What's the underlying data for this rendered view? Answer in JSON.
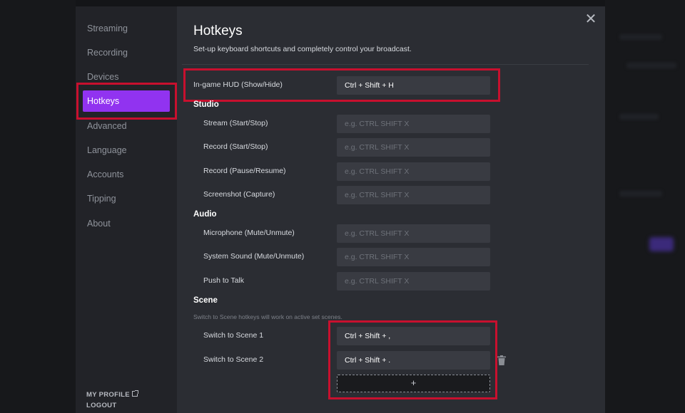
{
  "sidebar": {
    "items": [
      {
        "label": "Streaming"
      },
      {
        "label": "Recording"
      },
      {
        "label": "Devices"
      },
      {
        "label": "Hotkeys"
      },
      {
        "label": "Advanced"
      },
      {
        "label": "Language"
      },
      {
        "label": "Accounts"
      },
      {
        "label": "Tipping"
      },
      {
        "label": "About"
      }
    ],
    "active": "Hotkeys",
    "my_profile": "MY PROFILE",
    "logout": "LOGOUT"
  },
  "header": {
    "title": "Hotkeys",
    "subtitle": "Set-up keyboard shortcuts and completely control your broadcast.",
    "close_icon": "close-icon"
  },
  "hud": {
    "label": "In-game HUD (Show/Hide)",
    "value": "Ctrl + Shift + H"
  },
  "placeholder": "e.g. CTRL SHIFT X",
  "studio": {
    "heading": "Studio",
    "rows": [
      {
        "label": "Stream (Start/Stop)",
        "value": ""
      },
      {
        "label": "Record (Start/Stop)",
        "value": ""
      },
      {
        "label": "Record (Pause/Resume)",
        "value": ""
      },
      {
        "label": "Screenshot (Capture)",
        "value": ""
      }
    ]
  },
  "audio": {
    "heading": "Audio",
    "rows": [
      {
        "label": "Microphone (Mute/Unmute)",
        "value": ""
      },
      {
        "label": "System Sound (Mute/Unmute)",
        "value": ""
      },
      {
        "label": "Push to Talk",
        "value": ""
      }
    ]
  },
  "scene": {
    "heading": "Scene",
    "note": "Switch to Scene hotkeys will work on active set scenes.",
    "rows": [
      {
        "label": "Switch to Scene 1",
        "value": "Ctrl + Shift + ,"
      },
      {
        "label": "Switch to Scene 2",
        "value": "Ctrl + Shift + ."
      }
    ],
    "add_label": "+",
    "delete_icon": "trash-icon"
  },
  "colors": {
    "accent": "#9133f0",
    "highlight_box": "#c8102e",
    "modal_bg": "#2b2d33",
    "sidebar_bg": "#222328",
    "input_bg": "#393b42"
  }
}
